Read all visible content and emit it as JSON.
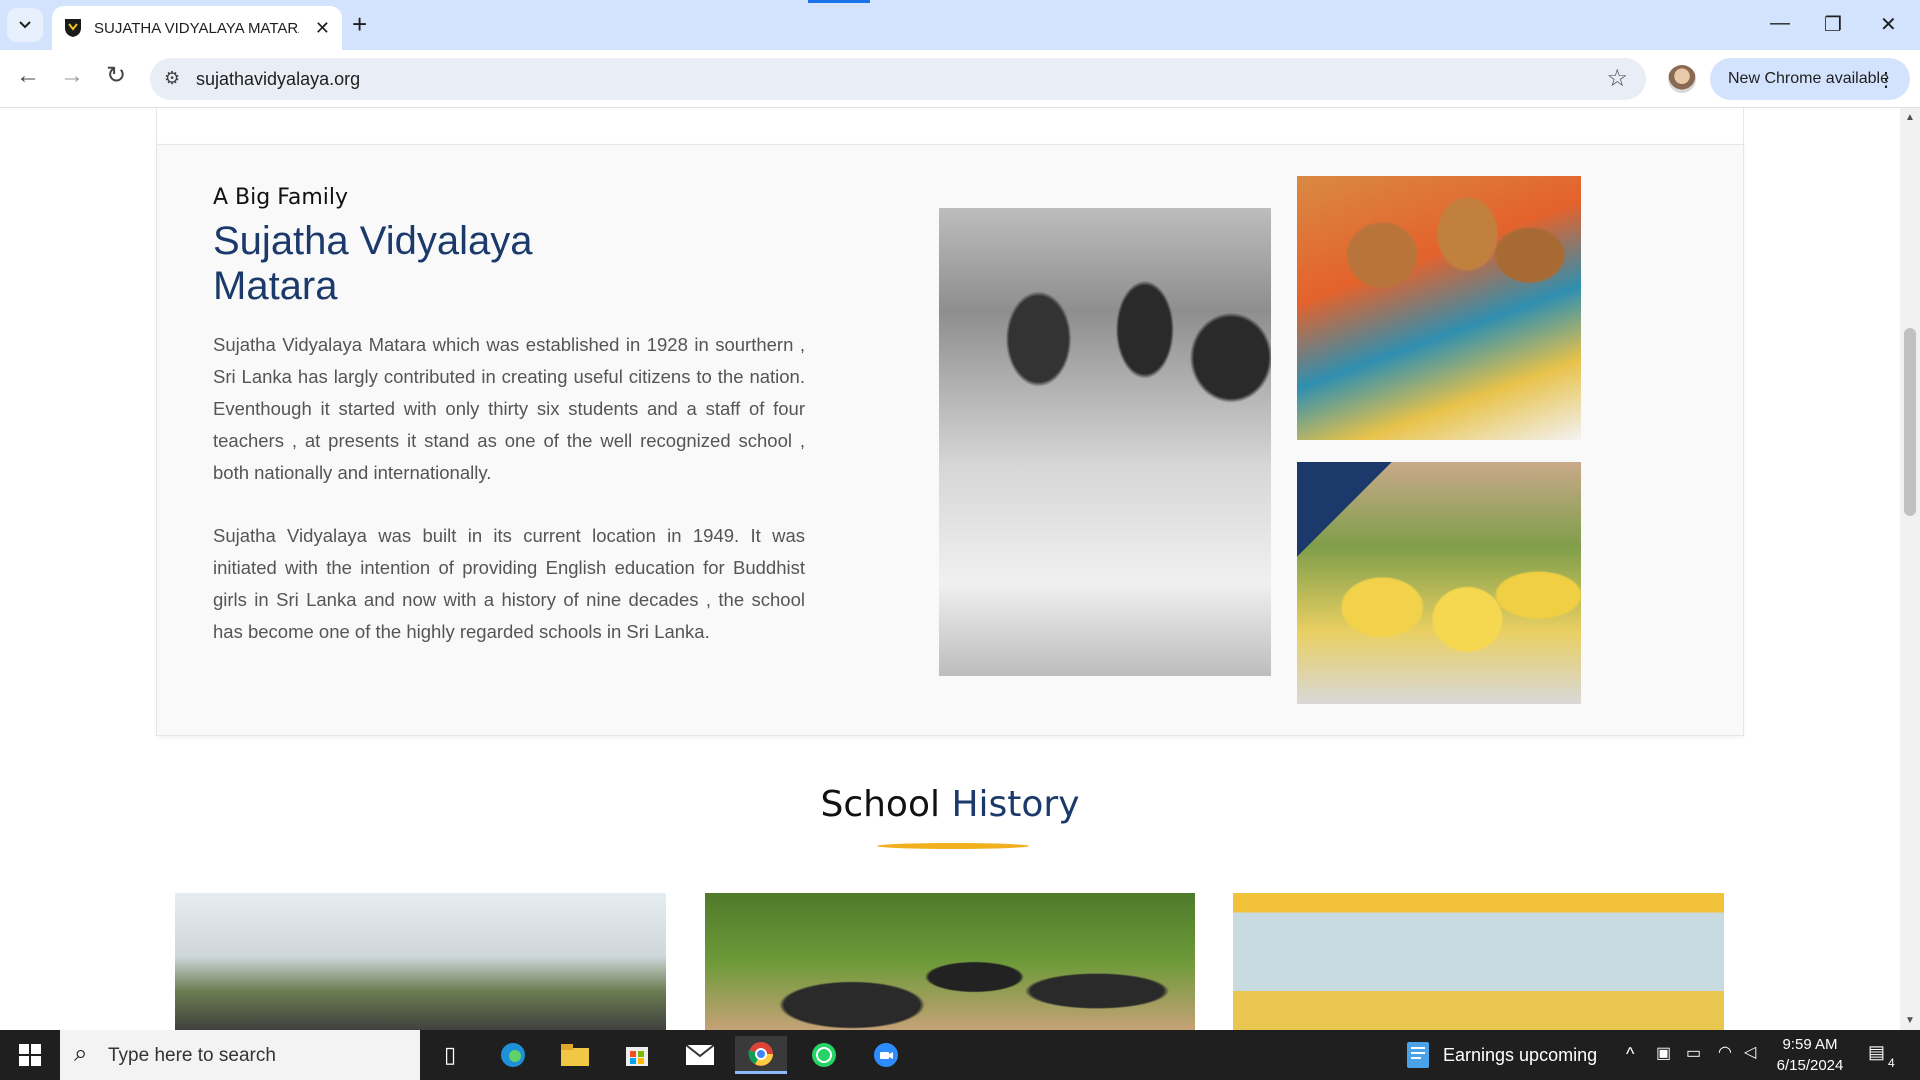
{
  "browser": {
    "tab_title": "SUJATHA VIDYALAYA MATARA |",
    "url": "sujathavidyalaya.org",
    "update_label": "New Chrome available"
  },
  "about": {
    "kicker": "A Big Family",
    "heading_line1": "Sujatha Vidyalaya",
    "heading_line2": "Matara",
    "para1": "Sujatha Vidyalaya Matara which was established in 1928 in sourthern , Sri Lanka has largly contributed in creating useful citizens to the nation. Eventhough it started with only thirty six students and a staff of four teachers , at presents it stand as one of the well recognized school , both nationally and internationally.",
    "para2": "Sujatha Vidyalaya was built in its current location in 1949. It was initiated with the intention of providing English education for Buddhist girls in Sri Lanka and now with a history of nine decades , the school has become one of the highly regarded schools in Sri Lanka."
  },
  "history": {
    "title_part1": "School",
    "title_part2": "History"
  },
  "taskbar": {
    "search_placeholder": "Type here to search",
    "news_widget": "Earnings upcoming",
    "time": "9:59 AM",
    "date": "6/15/2024",
    "notification_count": "4"
  },
  "colors": {
    "heading_blue": "#1b3a6b",
    "underline_yellow": "#f2b01e",
    "chrome_accent": "#d3e3fd"
  }
}
